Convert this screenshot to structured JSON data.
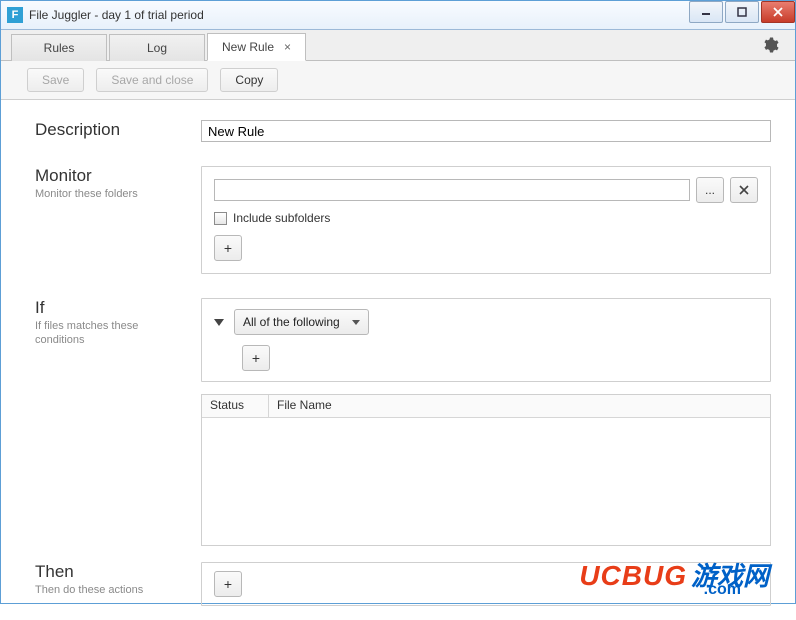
{
  "window": {
    "title": "File Juggler - day 1 of trial period",
    "icon_letter": "F"
  },
  "tabs": {
    "rules": "Rules",
    "log": "Log",
    "newrule": "New Rule"
  },
  "toolbar": {
    "save": "Save",
    "save_close": "Save and close",
    "copy": "Copy"
  },
  "sections": {
    "description": {
      "title": "Description",
      "value": "New Rule"
    },
    "monitor": {
      "title": "Monitor",
      "sub": "Monitor these folders",
      "folder_value": "",
      "browse_label": "...",
      "include_subfolders": "Include subfolders"
    },
    "if": {
      "title": "If",
      "sub": "If files matches these conditions",
      "match_mode": "All of the following",
      "table": {
        "col_status": "Status",
        "col_filename": "File Name"
      }
    },
    "then": {
      "title": "Then",
      "sub": "Then do these actions"
    }
  },
  "watermark": {
    "brand": "UCBUG",
    "cn": "游戏网",
    "domain": ".com"
  }
}
